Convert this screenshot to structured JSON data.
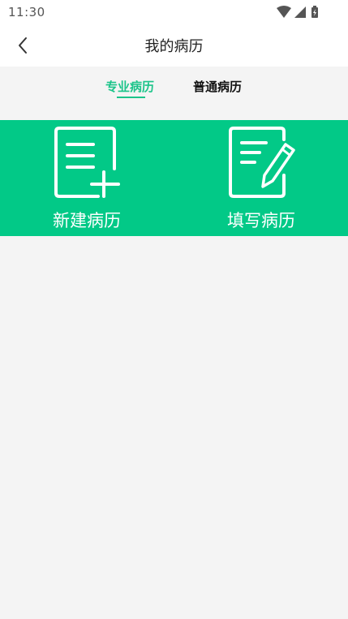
{
  "status_bar": {
    "time": "11:30",
    "icons": [
      "wifi-icon",
      "signal-icon",
      "battery-icon"
    ]
  },
  "header": {
    "title": "我的病历",
    "back_icon": "chevron-left-icon"
  },
  "tabs": [
    {
      "label": "专业病历",
      "active": true
    },
    {
      "label": "普通病历",
      "active": false
    }
  ],
  "actions": [
    {
      "label": "新建病历",
      "icon": "new-record-icon"
    },
    {
      "label": "填写病历",
      "icon": "edit-record-icon"
    }
  ],
  "colors": {
    "accent": "#1cc48a",
    "banner": "#02c987",
    "background": "#f4f4f4"
  }
}
